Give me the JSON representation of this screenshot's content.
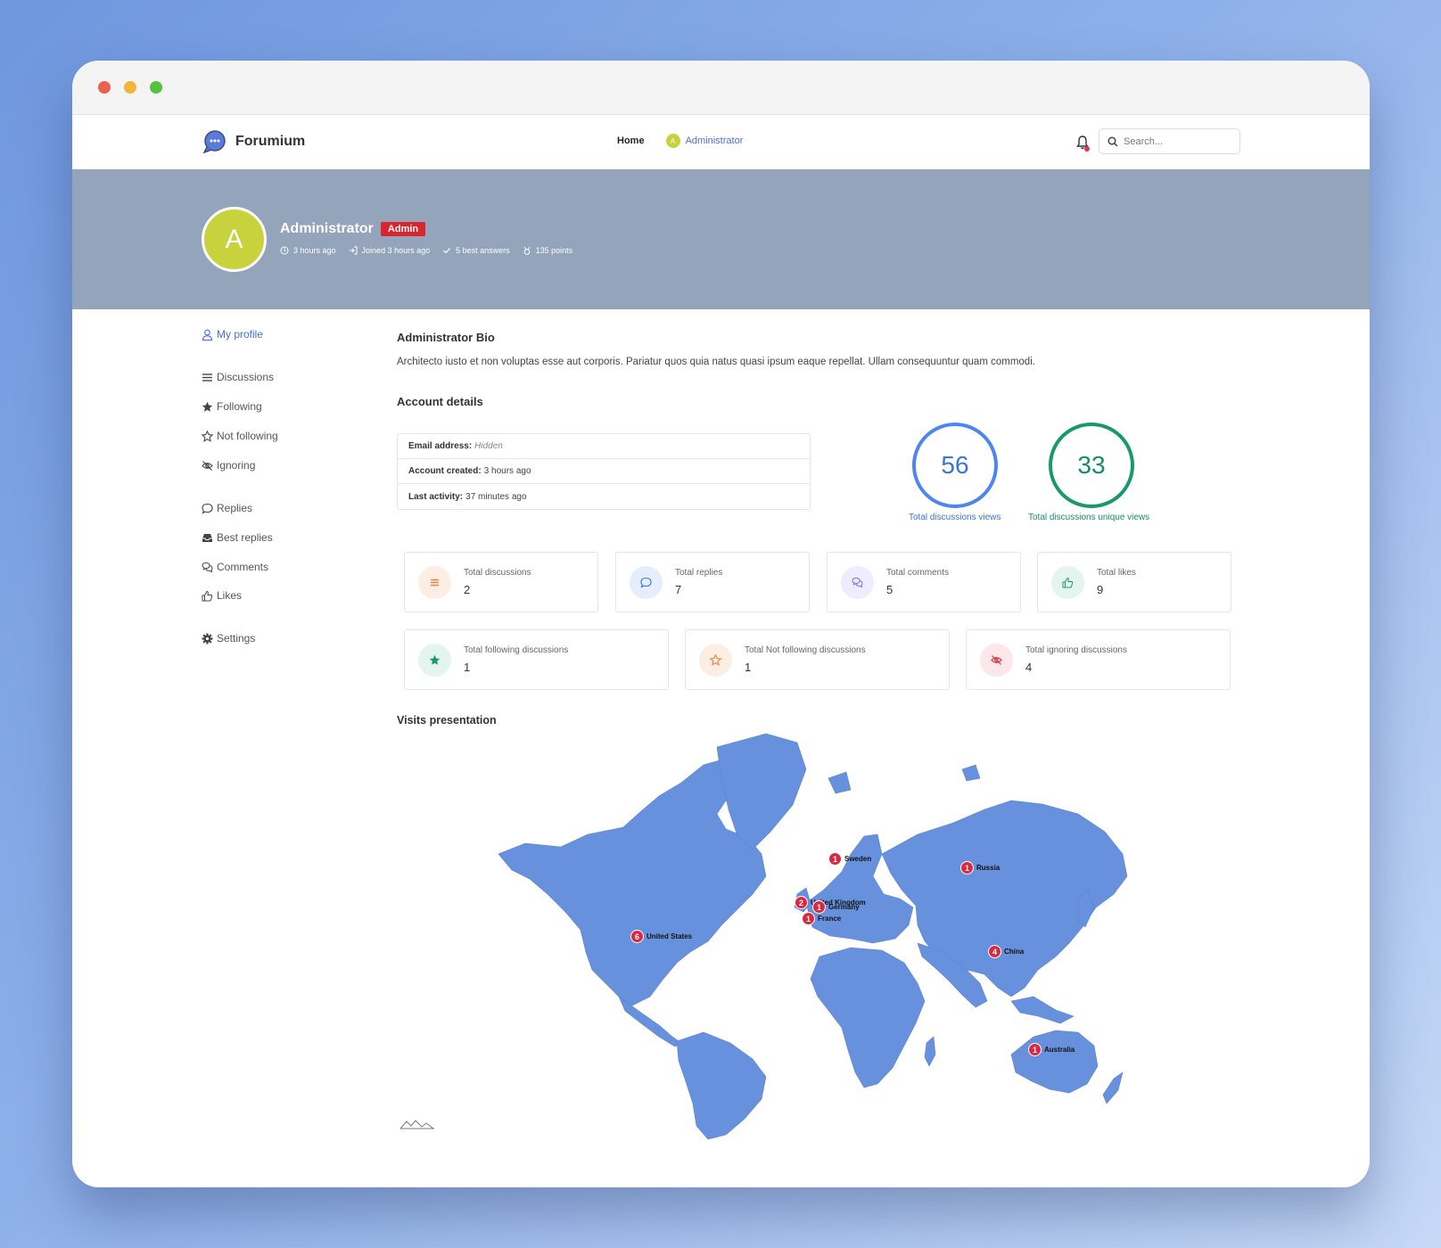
{
  "brand": {
    "name": "Forumium"
  },
  "nav": {
    "home": "Home",
    "user_initial": "A",
    "user_name": "Administrator"
  },
  "search": {
    "placeholder": "Search..."
  },
  "profile": {
    "initial": "A",
    "name": "Administrator",
    "badge": "Admin",
    "meta": [
      "3 hours ago",
      "Joined 3 hours ago",
      "5 best answers",
      "135 points"
    ]
  },
  "sidebar": {
    "items": [
      {
        "label": "My profile",
        "icon": "user-icon"
      },
      {
        "label": "Discussions",
        "icon": "list-icon"
      },
      {
        "label": "Following",
        "icon": "star-filled-icon"
      },
      {
        "label": "Not following",
        "icon": "star-outline-icon"
      },
      {
        "label": "Ignoring",
        "icon": "eye-slash-icon"
      },
      {
        "label": "Replies",
        "icon": "comment-icon"
      },
      {
        "label": "Best replies",
        "icon": "inbox-icon"
      },
      {
        "label": "Comments",
        "icon": "comments-icon"
      },
      {
        "label": "Likes",
        "icon": "thumbs-up-icon"
      },
      {
        "label": "Settings",
        "icon": "gear-icon"
      }
    ]
  },
  "bio": {
    "title": "Administrator Bio",
    "text": "Architecto iusto et non voluptas esse aut corporis. Pariatur quos quia natus quasi ipsum eaque repellat. Ullam consequuntur quam commodi."
  },
  "account": {
    "title": "Account details",
    "email_label": "Email address:",
    "email_value": "Hidden",
    "created_label": "Account created:",
    "created_value": "3 hours ago",
    "activity_label": "Last activity:",
    "activity_value": "37 minutes ago"
  },
  "views": {
    "total": "56",
    "total_label": "Total discussions views",
    "unique": "33",
    "unique_label": "Total discussions unique views"
  },
  "stats": [
    {
      "label": "Total discussions",
      "value": "2",
      "icon": "list-icon",
      "color": "#f07e3c",
      "bg": "#fdeee4"
    },
    {
      "label": "Total replies",
      "value": "7",
      "icon": "comment-icon",
      "color": "#3b73dc",
      "bg": "#e6eefc"
    },
    {
      "label": "Total comments",
      "value": "5",
      "icon": "comments-icon",
      "color": "#7b6cf0",
      "bg": "#efedfd"
    },
    {
      "label": "Total likes",
      "value": "9",
      "icon": "thumbs-up-icon",
      "color": "#17996a",
      "bg": "#e3f5ee"
    },
    {
      "label": "Total following discussions",
      "value": "1",
      "icon": "star-filled-icon",
      "color": "#17996a",
      "bg": "#e3f5ee"
    },
    {
      "label": "Total Not following discussions",
      "value": "1",
      "icon": "star-outline-icon",
      "color": "#f07e3c",
      "bg": "#fdeee4"
    },
    {
      "label": "Total ignoring discussions",
      "value": "4",
      "icon": "eye-slash-icon",
      "color": "#d9283f",
      "bg": "#fde7ea"
    }
  ],
  "visits": {
    "title": "Visits presentation",
    "markers": [
      {
        "country": "Sweden",
        "count": "1"
      },
      {
        "country": "Russia",
        "count": "1"
      },
      {
        "country": "United Kingdom",
        "count": "2"
      },
      {
        "country": "Germany",
        "count": "1"
      },
      {
        "country": "France",
        "count": "1"
      },
      {
        "country": "United States",
        "count": "6"
      },
      {
        "country": "China",
        "count": "4"
      },
      {
        "country": "Australia",
        "count": "1"
      }
    ]
  }
}
